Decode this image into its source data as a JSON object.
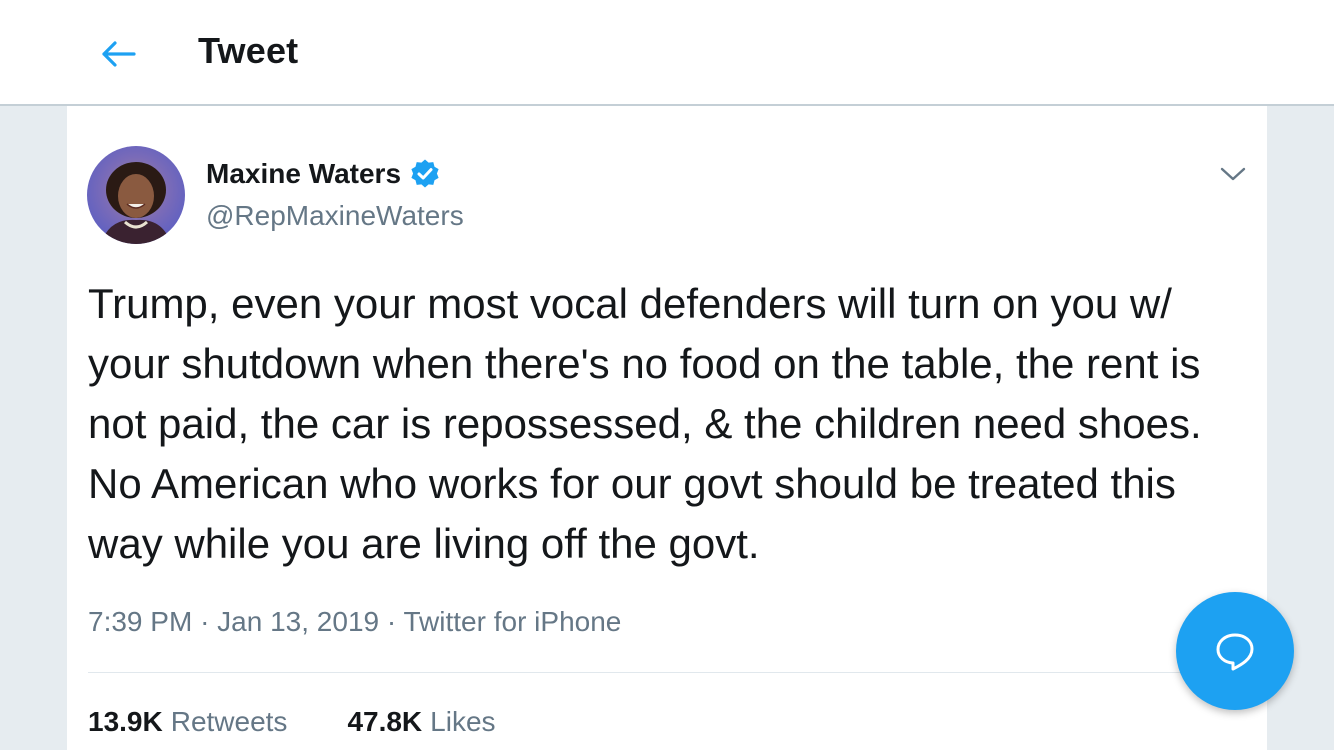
{
  "header": {
    "title": "Tweet",
    "back_icon": "arrow-left-icon",
    "accent_color": "#1da1f2"
  },
  "tweet": {
    "author": {
      "name": "Maxine Waters",
      "handle": "@RepMaxineWaters",
      "verified": true
    },
    "text": "Trump, even your most vocal defenders will turn on you w/ your shutdown when there's no food on the table, the rent is not paid, the car is repossessed, & the children need shoes. No American who works for our govt should be treated this way while you are living off the govt.",
    "time": "7:39 PM",
    "date": "Jan 13, 2019",
    "source": "Twitter for iPhone",
    "separator": "·",
    "retweets": {
      "count": "13.9K",
      "label": "Retweets"
    },
    "likes": {
      "count": "47.8K",
      "label": "Likes"
    }
  },
  "fab": {
    "icon": "compose-reply-icon"
  }
}
